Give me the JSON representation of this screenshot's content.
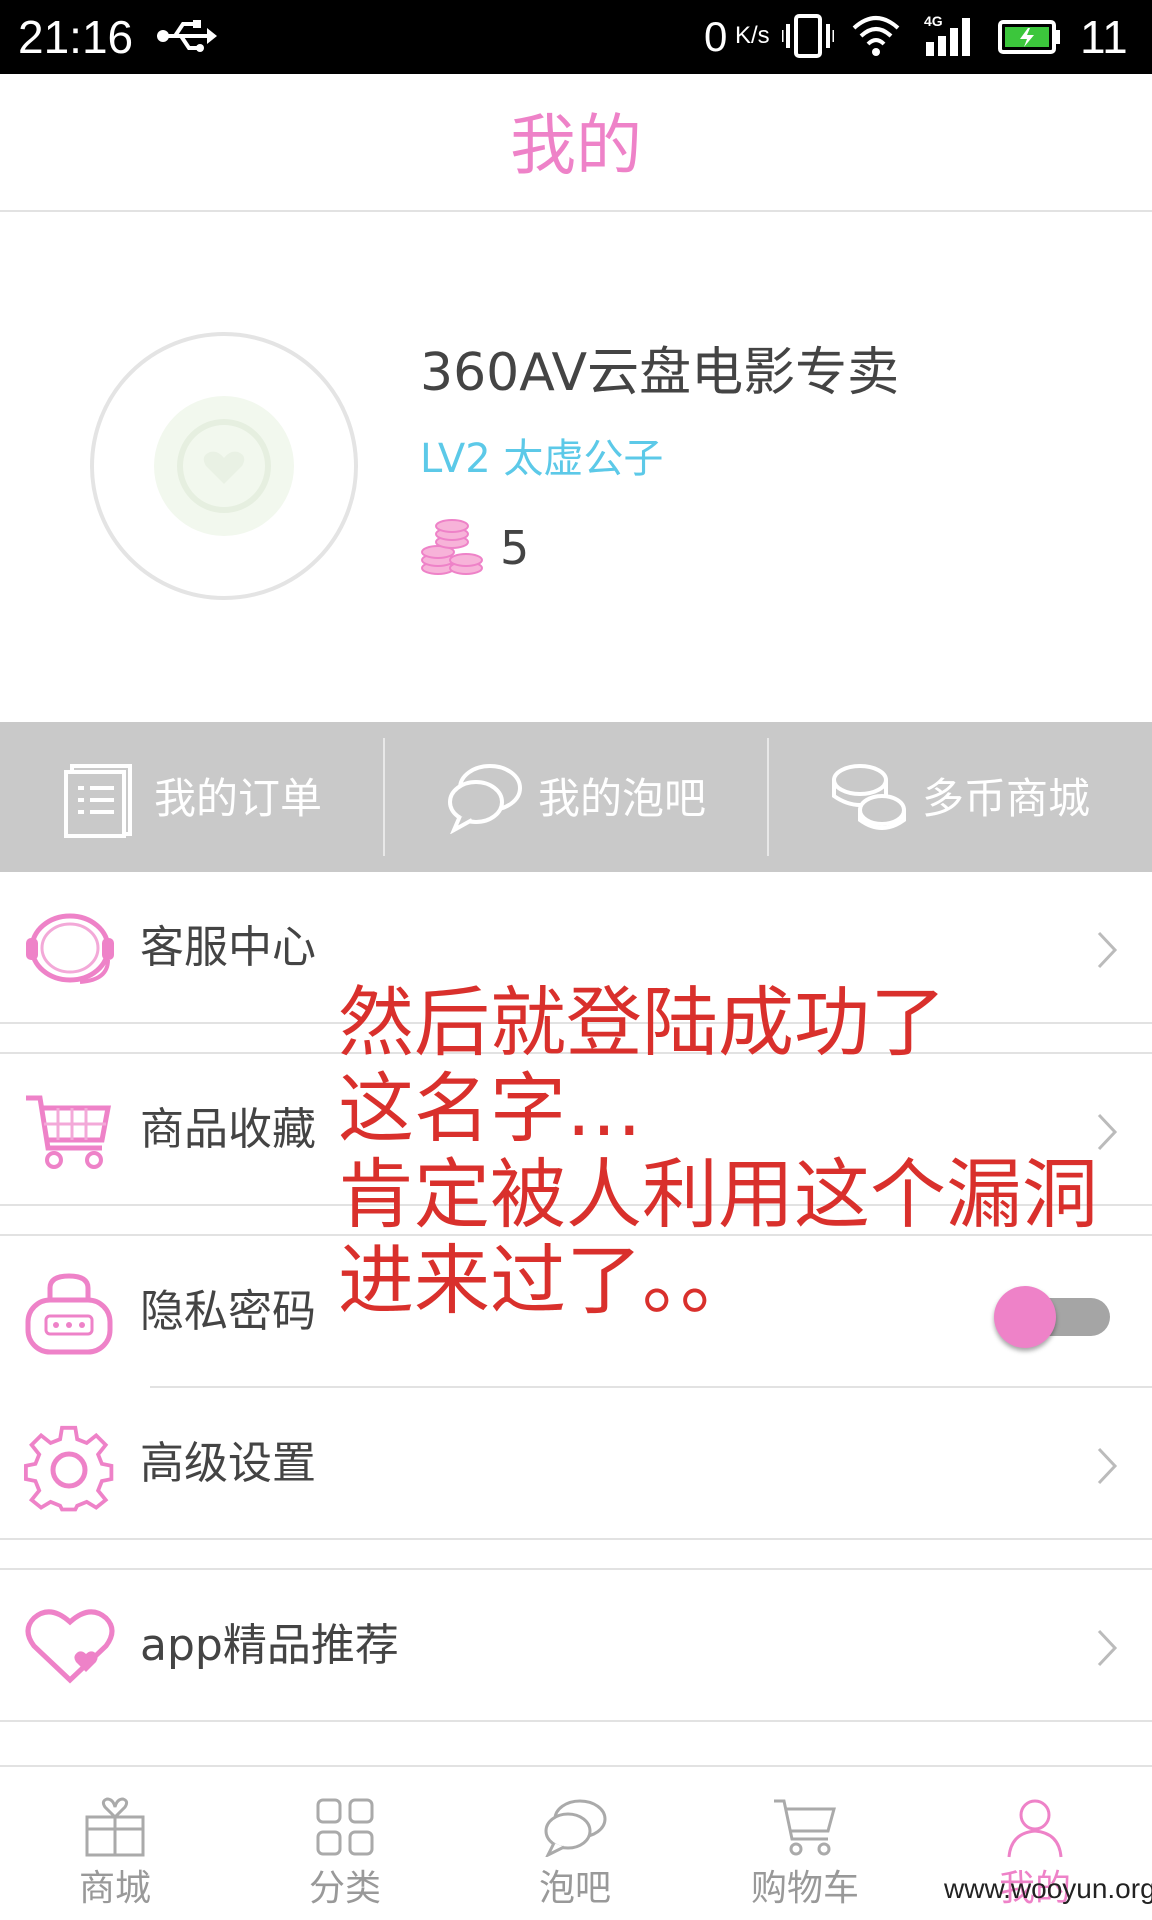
{
  "status_bar": {
    "time": "21:16",
    "net_speed": "0",
    "net_unit": "K/s",
    "network": "4G",
    "battery": "11"
  },
  "header": {
    "title": "我的"
  },
  "profile": {
    "username": "360AV云盘电影专卖",
    "level": "LV2 太虚公子",
    "coins": "5"
  },
  "quick_links": [
    {
      "label": "我的订单",
      "icon": "order-list-icon"
    },
    {
      "label": "我的泡吧",
      "icon": "chat-bubbles-icon"
    },
    {
      "label": "多币商城",
      "icon": "coins-icon"
    }
  ],
  "menu": [
    {
      "label": "客服中心",
      "icon": "headset-icon"
    },
    {
      "label": "商品收藏",
      "icon": "cart-icon"
    },
    {
      "label": "隐私密码",
      "icon": "lock-icon",
      "toggle_on": true
    },
    {
      "label": "高级设置",
      "icon": "gear-icon"
    },
    {
      "label": "app精品推荐",
      "icon": "heart-icon"
    }
  ],
  "annotation": {
    "line1": "然后就登陆成功了",
    "line2": "这名字…",
    "line3": "肯定被人利用这个漏洞",
    "line4": "进来过了。。"
  },
  "tabs": [
    {
      "label": "商城",
      "icon": "gift-icon",
      "active": false
    },
    {
      "label": "分类",
      "icon": "grid-icon",
      "active": false
    },
    {
      "label": "泡吧",
      "icon": "chat-icon",
      "active": false
    },
    {
      "label": "购物车",
      "icon": "cart-icon",
      "active": false
    },
    {
      "label": "我的",
      "icon": "user-icon",
      "active": true
    }
  ],
  "watermark": "www.wooyun.org",
  "colors": {
    "accent": "#ee82c8",
    "level": "#5cc9e8",
    "annotation": "#d9302c",
    "quickbar": "#c9c9c9"
  }
}
